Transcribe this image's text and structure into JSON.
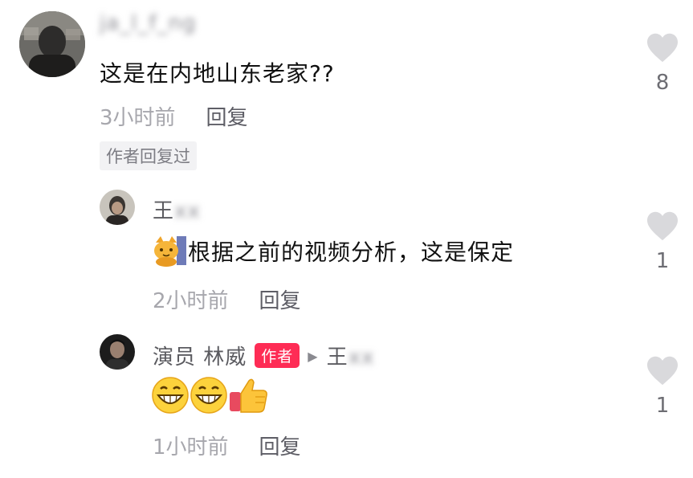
{
  "comment1": {
    "username": "ja_l_f_ng",
    "text": "这是在内地山东老家??",
    "time": "3小时前",
    "reply_label": "回复",
    "author_replied_tag": "作者回复过",
    "like_count": "8"
  },
  "reply1": {
    "username_visible": "王",
    "username_blurred": "xx",
    "text": "根据之前的视频分析，这是保定",
    "time": "2小时前",
    "reply_label": "回复",
    "like_count": "1"
  },
  "reply2": {
    "username": "演员 林威",
    "author_badge": "作者",
    "reply_to_visible": "王",
    "reply_to_blurred": "xx",
    "time": "1小时前",
    "reply_label": "回复",
    "like_count": "1"
  },
  "icons": {
    "like": "heart-icon",
    "reply_arrow": "play-arrow-icon",
    "emojis": [
      "cat-icon",
      "grin-icon",
      "thumbs-up-icon"
    ]
  },
  "colors": {
    "author_badge": "#fe2c55",
    "heart": "#d9d9dc"
  }
}
